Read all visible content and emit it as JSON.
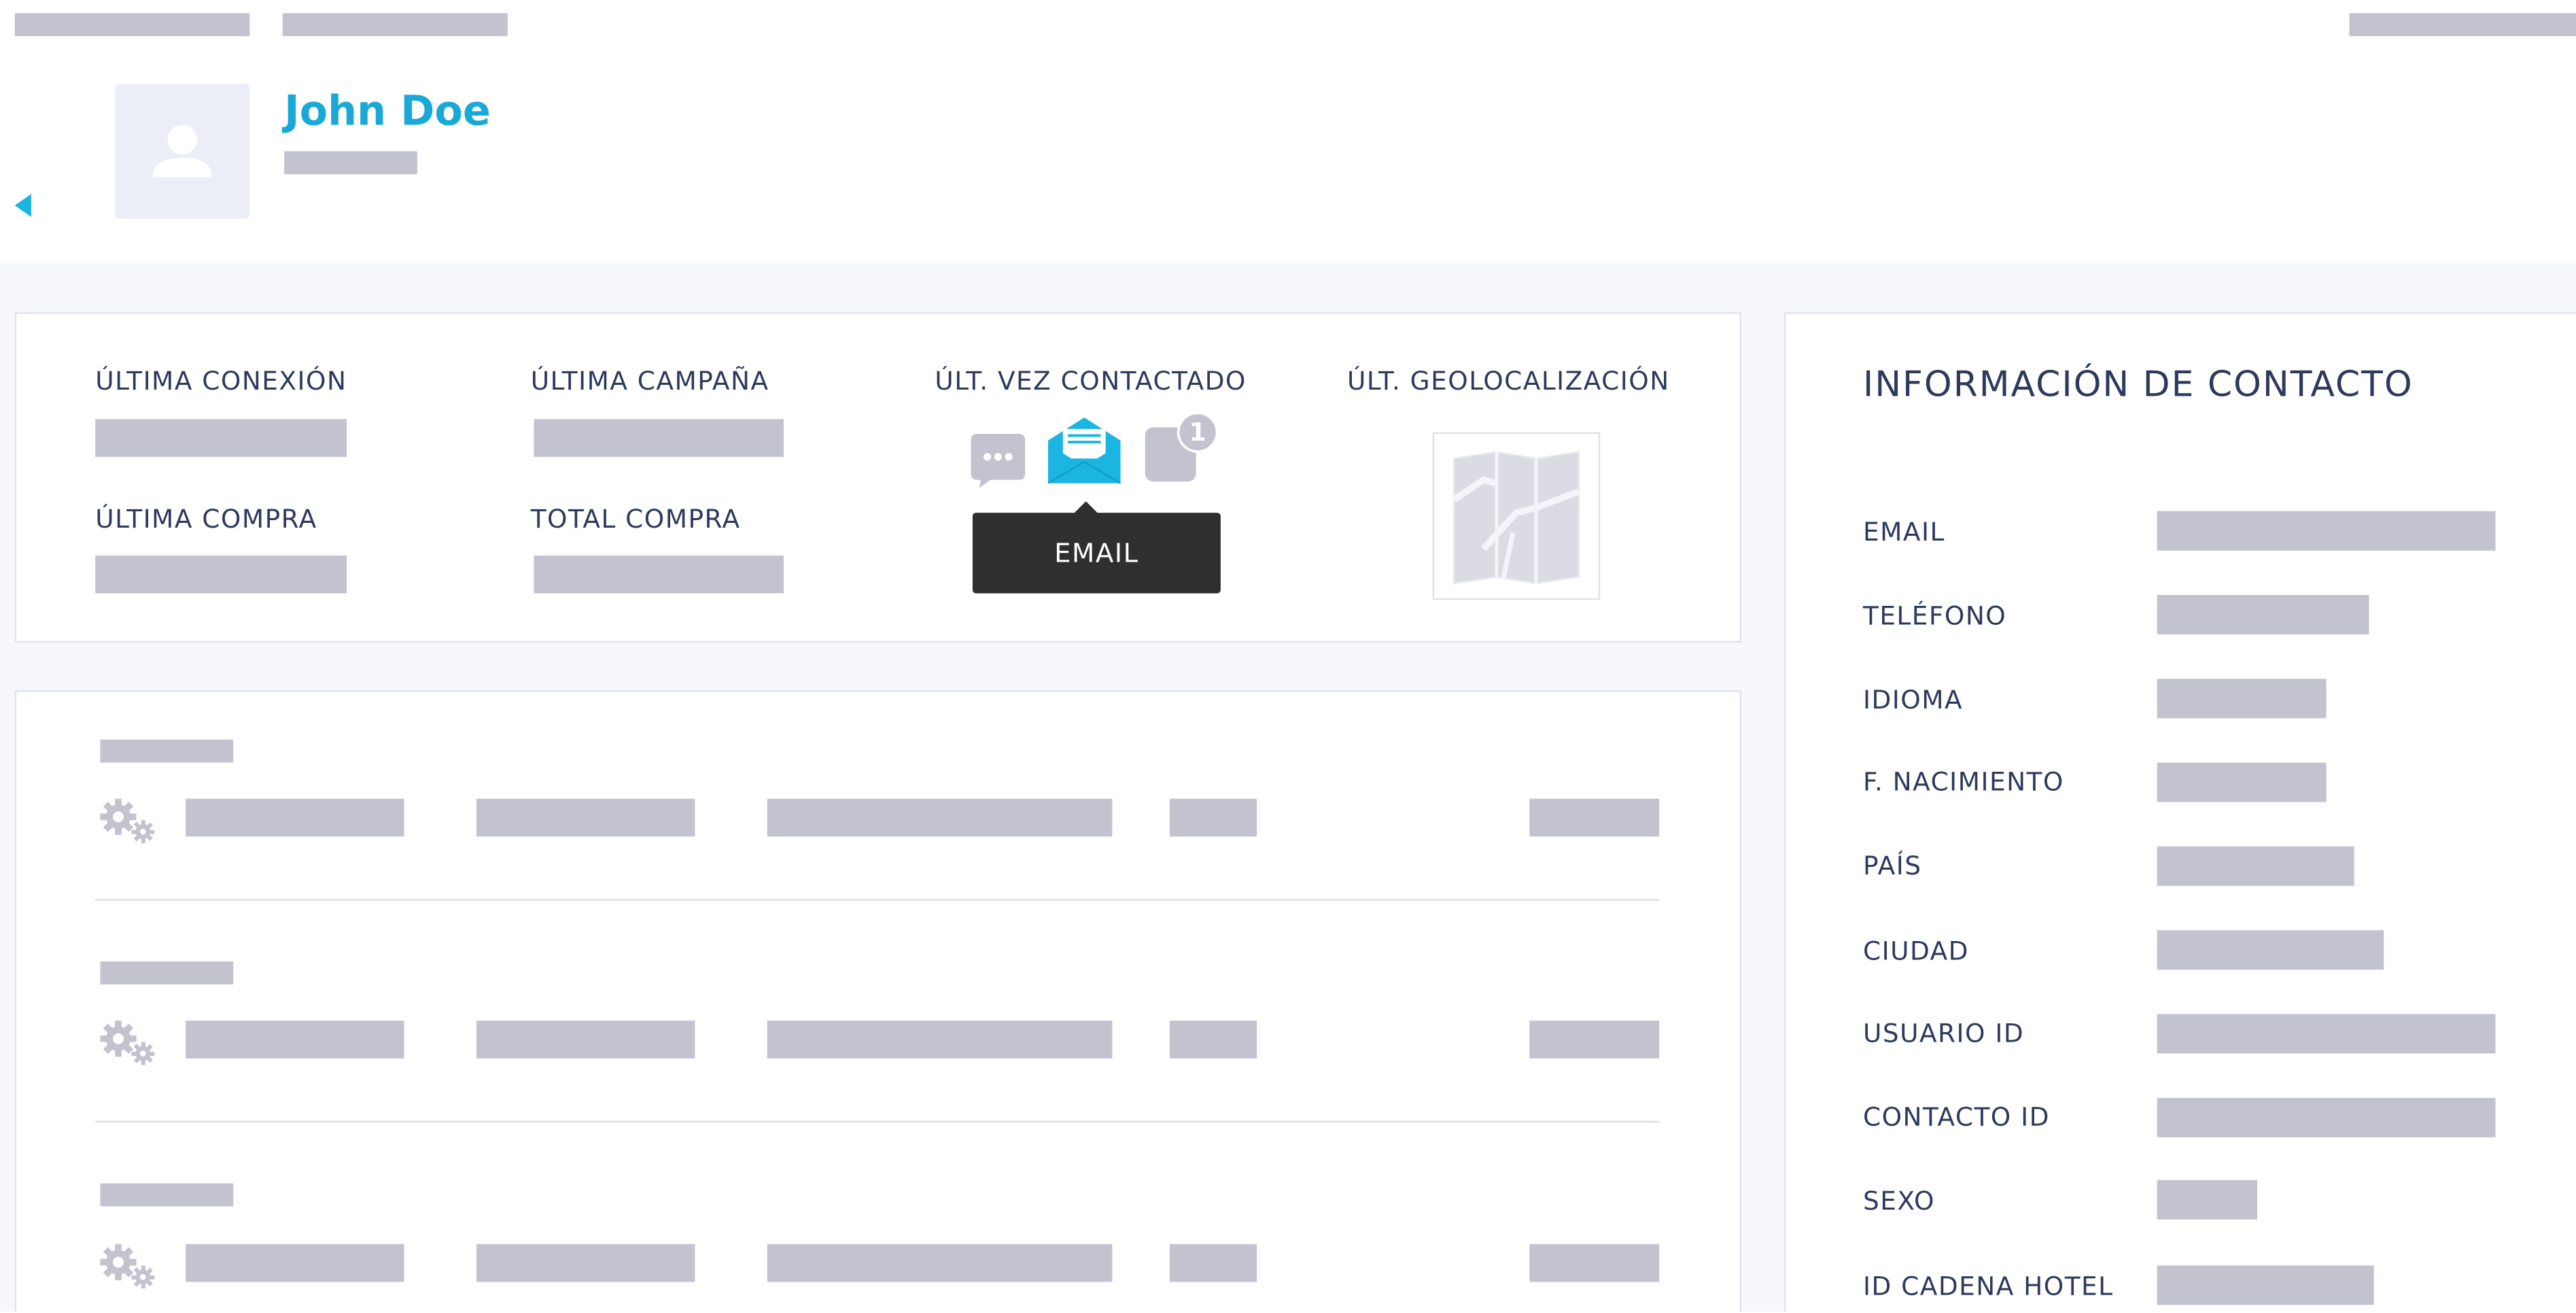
{
  "profile": {
    "name": "John Doe",
    "name_color": "#1aa9d6"
  },
  "icons": {
    "back": "triangle-left-icon",
    "avatar": "user-avatar-icon",
    "chat": "chat-bubble-icon",
    "email": "envelope-open-icon",
    "notification": "notification-icon",
    "map": "map-icon",
    "settings": "gears-icon"
  },
  "colors": {
    "accent": "#1ab5e0",
    "label": "#2e3a5c",
    "placeholder": "#c2c3cf",
    "panel_bg": "#f7f8fc",
    "tooltip_bg": "#2f2f2f"
  },
  "stats": {
    "ultima_conexion": "ÚLTIMA CONEXIÓN",
    "ultima_campana": "ÚLTIMA CAMPAÑA",
    "ult_vez_contactado": "ÚLT. VEZ CONTACTADO",
    "ult_geolocalizacion": "ÚLT. GEOLOCALIZACIÓN",
    "ultima_compra": "ÚLTIMA COMPRA",
    "total_compra": "TOTAL COMPRA",
    "notification_count": "1",
    "tooltip": "EMAIL"
  },
  "contact": {
    "title": "INFORMACIÓN DE CONTACTO",
    "fields": [
      {
        "label": "EMAIL"
      },
      {
        "label": "TELÉFONO"
      },
      {
        "label": "IDIOMA"
      },
      {
        "label": "F. NACIMIENTO"
      },
      {
        "label": "PAÍS"
      },
      {
        "label": "CIUDAD"
      },
      {
        "label": "USUARIO ID"
      },
      {
        "label": "CONTACTO ID"
      },
      {
        "label": "SEXO"
      },
      {
        "label": "ID CADENA HOTEL"
      }
    ]
  }
}
